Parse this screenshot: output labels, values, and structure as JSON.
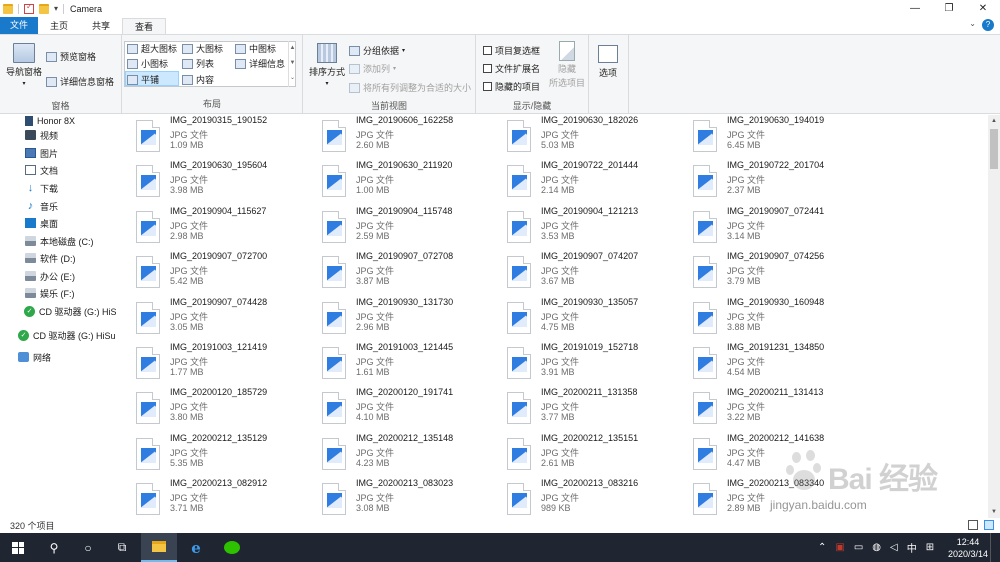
{
  "window": {
    "title": "Camera"
  },
  "tabs": [
    "文件",
    "主页",
    "共享",
    "查看"
  ],
  "ribbon": {
    "panes": {
      "nav_pane": "导航窗格",
      "preview_pane": "预览窗格",
      "details_pane": "详细信息窗格",
      "label": "窗格"
    },
    "layout": {
      "extra_large": "超大图标",
      "large": "大图标",
      "medium": "中图标",
      "small": "小图标",
      "list": "列表",
      "details": "详细信息",
      "tiles": "平铺",
      "content": "内容",
      "label": "布局"
    },
    "current_view": {
      "sort_by": "排序方式",
      "group_by": "分组依据",
      "add_columns": "添加列",
      "size_all_columns": "将所有列调整为合适的大小",
      "label": "当前视图"
    },
    "show_hide": {
      "item_checkboxes": "项目复选框",
      "file_extensions": "文件扩展名",
      "hidden_items": "隐藏的项目",
      "hide_selected": "隐藏",
      "hide_selected_sub": "所选项目",
      "label": "显示/隐藏"
    },
    "options": "选项"
  },
  "nav": [
    {
      "label": "Honor 8X",
      "icon": "phone-icon"
    },
    {
      "label": "视频",
      "icon": "video-icon"
    },
    {
      "label": "图片",
      "icon": "pictures-icon"
    },
    {
      "label": "文档",
      "icon": "documents-icon"
    },
    {
      "label": "下载",
      "icon": "download-icon"
    },
    {
      "label": "音乐",
      "icon": "music-icon"
    },
    {
      "label": "桌面",
      "icon": "desktop-icon"
    },
    {
      "label": "本地磁盘 (C:)",
      "icon": "drive-icon"
    },
    {
      "label": "软件 (D:)",
      "icon": "drive-icon"
    },
    {
      "label": "办公 (E:)",
      "icon": "drive-icon"
    },
    {
      "label": "娱乐 (F:)",
      "icon": "drive-icon"
    },
    {
      "label": "CD 驱动器 (G:) HiS",
      "icon": "cd-drive-icon"
    },
    {
      "label": "CD 驱动器 (G:) HiSu",
      "icon": "cd-drive-icon"
    },
    {
      "label": "网络",
      "icon": "network-icon"
    }
  ],
  "files": [
    {
      "name": "IMG_20190315_190152",
      "type": "JPG 文件",
      "size": "1.09 MB"
    },
    {
      "name": "IMG_20190606_162258",
      "type": "JPG 文件",
      "size": "2.60 MB"
    },
    {
      "name": "IMG_20190630_182026",
      "type": "JPG 文件",
      "size": "5.03 MB"
    },
    {
      "name": "IMG_20190630_194019",
      "type": "JPG 文件",
      "size": "6.45 MB"
    },
    {
      "name": "IMG_20190630_195604",
      "type": "JPG 文件",
      "size": "3.98 MB"
    },
    {
      "name": "IMG_20190630_211920",
      "type": "JPG 文件",
      "size": "1.00 MB"
    },
    {
      "name": "IMG_20190722_201444",
      "type": "JPG 文件",
      "size": "2.14 MB"
    },
    {
      "name": "IMG_20190722_201704",
      "type": "JPG 文件",
      "size": "2.37 MB"
    },
    {
      "name": "IMG_20190904_115627",
      "type": "JPG 文件",
      "size": "2.98 MB"
    },
    {
      "name": "IMG_20190904_115748",
      "type": "JPG 文件",
      "size": "2.59 MB"
    },
    {
      "name": "IMG_20190904_121213",
      "type": "JPG 文件",
      "size": "3.53 MB"
    },
    {
      "name": "IMG_20190907_072441",
      "type": "JPG 文件",
      "size": "3.14 MB"
    },
    {
      "name": "IMG_20190907_072700",
      "type": "JPG 文件",
      "size": "5.42 MB"
    },
    {
      "name": "IMG_20190907_072708",
      "type": "JPG 文件",
      "size": "3.87 MB"
    },
    {
      "name": "IMG_20190907_074207",
      "type": "JPG 文件",
      "size": "3.67 MB"
    },
    {
      "name": "IMG_20190907_074256",
      "type": "JPG 文件",
      "size": "3.79 MB"
    },
    {
      "name": "IMG_20190907_074428",
      "type": "JPG 文件",
      "size": "3.05 MB"
    },
    {
      "name": "IMG_20190930_131730",
      "type": "JPG 文件",
      "size": "2.96 MB"
    },
    {
      "name": "IMG_20190930_135057",
      "type": "JPG 文件",
      "size": "4.75 MB"
    },
    {
      "name": "IMG_20190930_160948",
      "type": "JPG 文件",
      "size": "3.88 MB"
    },
    {
      "name": "IMG_20191003_121419",
      "type": "JPG 文件",
      "size": "1.77 MB"
    },
    {
      "name": "IMG_20191003_121445",
      "type": "JPG 文件",
      "size": "1.61 MB"
    },
    {
      "name": "IMG_20191019_152718",
      "type": "JPG 文件",
      "size": "3.91 MB"
    },
    {
      "name": "IMG_20191231_134850",
      "type": "JPG 文件",
      "size": "4.54 MB"
    },
    {
      "name": "IMG_20200120_185729",
      "type": "JPG 文件",
      "size": "3.80 MB"
    },
    {
      "name": "IMG_20200120_191741",
      "type": "JPG 文件",
      "size": "4.10 MB"
    },
    {
      "name": "IMG_20200211_131358",
      "type": "JPG 文件",
      "size": "3.77 MB"
    },
    {
      "name": "IMG_20200211_131413",
      "type": "JPG 文件",
      "size": "3.22 MB"
    },
    {
      "name": "IMG_20200212_135129",
      "type": "JPG 文件",
      "size": "5.35 MB"
    },
    {
      "name": "IMG_20200212_135148",
      "type": "JPG 文件",
      "size": "4.23 MB"
    },
    {
      "name": "IMG_20200212_135151",
      "type": "JPG 文件",
      "size": "2.61 MB"
    },
    {
      "name": "IMG_20200212_141638",
      "type": "JPG 文件",
      "size": "4.47 MB"
    },
    {
      "name": "IMG_20200213_082912",
      "type": "JPG 文件",
      "size": "3.71 MB"
    },
    {
      "name": "IMG_20200213_083023",
      "type": "JPG 文件",
      "size": "3.08 MB"
    },
    {
      "name": "IMG_20200213_083216",
      "type": "JPG 文件",
      "size": "989 KB"
    },
    {
      "name": "IMG_20200213_083340",
      "type": "JPG 文件",
      "size": "2.89 MB"
    }
  ],
  "status": {
    "item_count": "320 个项目"
  },
  "watermark": {
    "logo_text": "Bai 经验",
    "url": "jingyan.baidu.com"
  },
  "taskbar": {
    "time": "12:44",
    "date": "2020/3/14",
    "ime": "中"
  },
  "colors": {
    "accent": "#1979ca",
    "selection": "#cce8ff",
    "taskbar": "#1f2631"
  }
}
